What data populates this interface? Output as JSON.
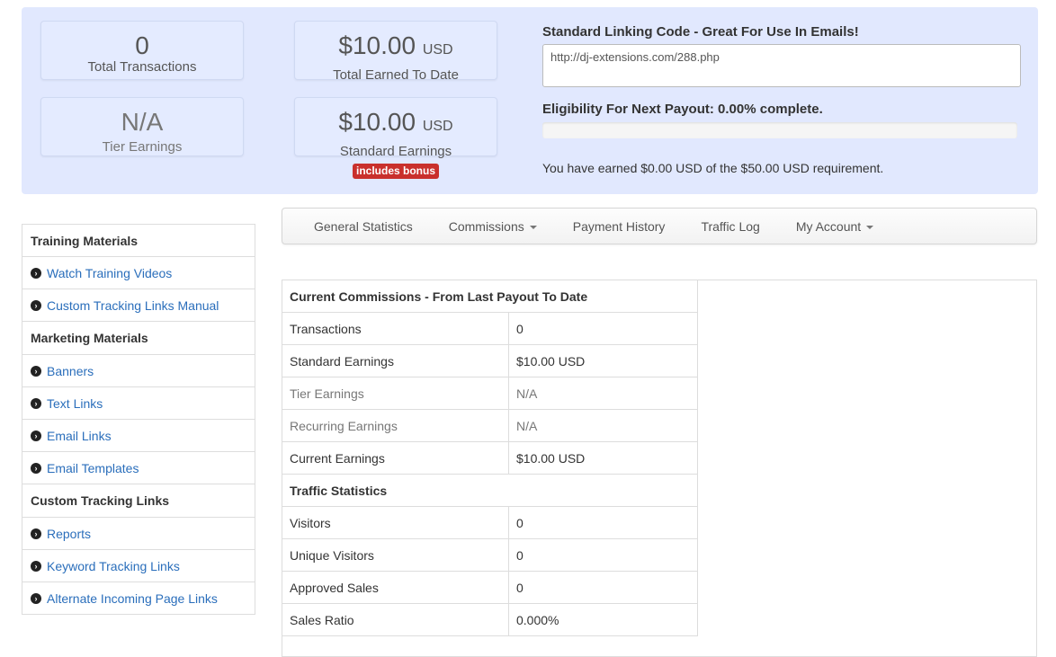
{
  "summary": {
    "total_transactions": {
      "value": "0",
      "label": "Total Transactions"
    },
    "total_earned": {
      "value": "$10.00",
      "unit": "USD",
      "label": "Total Earned To Date"
    },
    "tier_earnings": {
      "value": "N/A",
      "label": "Tier Earnings"
    },
    "standard_earnings": {
      "value": "$10.00",
      "unit": "USD",
      "label": "Standard Earnings",
      "badge": "includes bonus"
    }
  },
  "linking": {
    "title": "Standard Linking Code - Great For Use In Emails!",
    "code": "http://dj-extensions.com/288.php"
  },
  "payout": {
    "title": "Eligibility For Next Payout: 0.00% complete.",
    "progress_percent": 0,
    "earned_text": "You have earned $0.00 USD of the $50.00 USD requirement."
  },
  "sidebar": [
    {
      "type": "head",
      "label": "Training Materials"
    },
    {
      "type": "link",
      "label": "Watch Training Videos"
    },
    {
      "type": "link",
      "label": "Custom Tracking Links Manual"
    },
    {
      "type": "head",
      "label": "Marketing Materials"
    },
    {
      "type": "link",
      "label": "Banners"
    },
    {
      "type": "link",
      "label": "Text Links"
    },
    {
      "type": "link",
      "label": "Email Links"
    },
    {
      "type": "link",
      "label": "Email Templates"
    },
    {
      "type": "head",
      "label": "Custom Tracking Links"
    },
    {
      "type": "link",
      "label": "Reports"
    },
    {
      "type": "link",
      "label": "Keyword Tracking Links"
    },
    {
      "type": "link",
      "label": "Alternate Incoming Page Links"
    }
  ],
  "nav": [
    {
      "label": "General Statistics",
      "dropdown": false
    },
    {
      "label": "Commissions",
      "dropdown": true
    },
    {
      "label": "Payment History",
      "dropdown": false
    },
    {
      "label": "Traffic Log",
      "dropdown": false
    },
    {
      "label": "My Account",
      "dropdown": true
    }
  ],
  "commissions": {
    "title": "Current Commissions - From Last Payout To Date",
    "rows": [
      {
        "label": "Transactions",
        "value": "0",
        "muted": false
      },
      {
        "label": "Standard Earnings",
        "value": "$10.00 USD",
        "muted": false
      },
      {
        "label": "Tier Earnings",
        "value": "N/A",
        "muted": true
      },
      {
        "label": "Recurring Earnings",
        "value": "N/A",
        "muted": true
      },
      {
        "label": "Current Earnings",
        "value": "$10.00 USD",
        "muted": false
      }
    ]
  },
  "traffic": {
    "title": "Traffic Statistics",
    "rows": [
      {
        "label": "Visitors",
        "value": "0"
      },
      {
        "label": "Unique Visitors",
        "value": "0"
      },
      {
        "label": "Approved Sales",
        "value": "0"
      },
      {
        "label": "Sales Ratio",
        "value": "0.000%"
      }
    ]
  }
}
